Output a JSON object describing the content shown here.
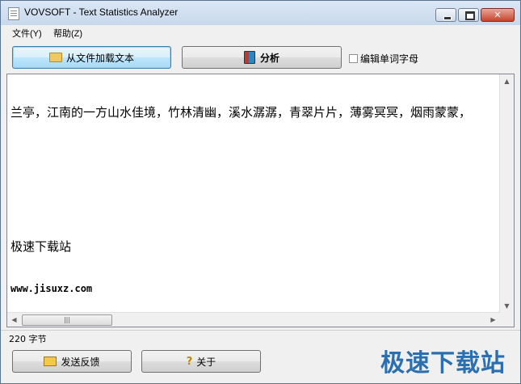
{
  "window": {
    "title": "VOVSOFT - Text Statistics Analyzer"
  },
  "menu": {
    "file": "文件(Y)",
    "help": "帮助(Z)"
  },
  "toolbar": {
    "load_label": "从文件加载文本",
    "analyze_label": "分析",
    "edit_checkbox_label": "编辑单词字母"
  },
  "editor": {
    "lines": [
      "兰亭，江南的一方山水佳境，竹林清幽，溪水潺潺，青翠片片，薄雾冥冥，烟雨蒙蒙，",
      "",
      "极速下载站",
      "www.jisuxz.com"
    ]
  },
  "status": {
    "bytes": "220 字节"
  },
  "footer": {
    "feedback_label": "发送反馈",
    "about_label": "关于"
  },
  "watermark": "极速下载站"
}
